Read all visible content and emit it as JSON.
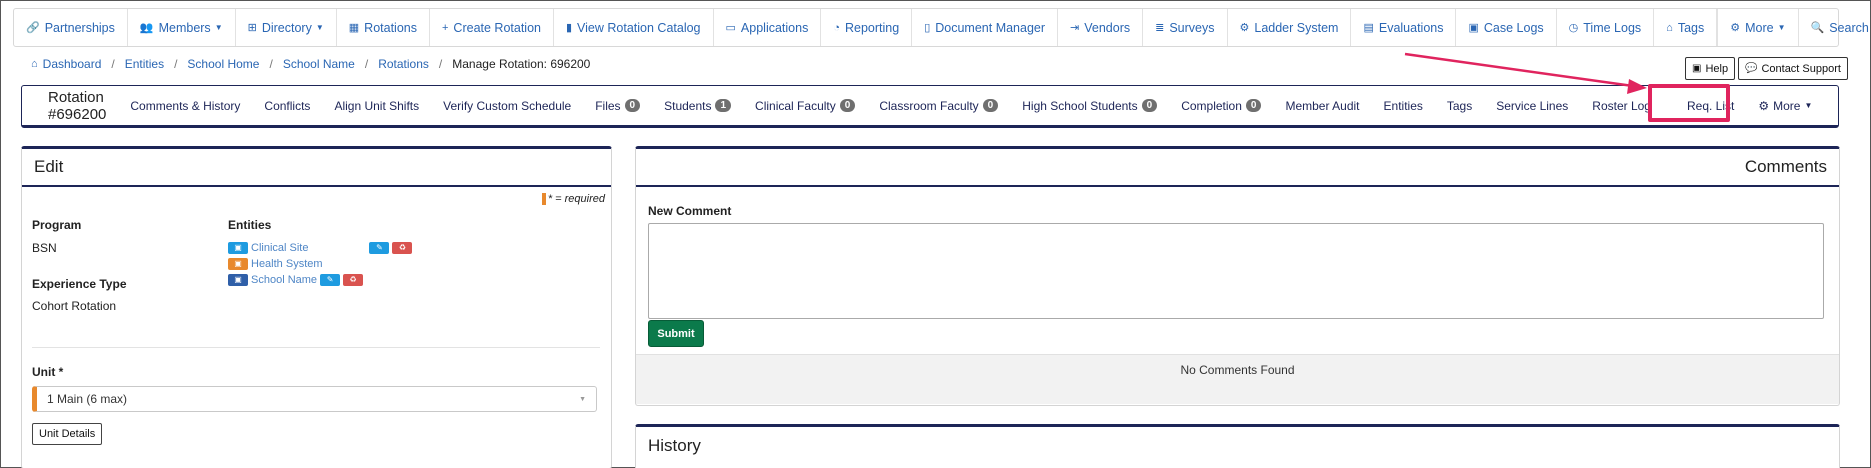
{
  "topnav": {
    "items": [
      {
        "label": "Partnerships",
        "icon": "link-icon",
        "glyph": "🔗",
        "caret": false
      },
      {
        "label": "Members",
        "icon": "users-icon",
        "glyph": "👥",
        "caret": true
      },
      {
        "label": "Directory",
        "icon": "sitemap-icon",
        "glyph": "⊞",
        "caret": true
      },
      {
        "label": "Rotations",
        "icon": "table-icon",
        "glyph": "▦",
        "caret": false
      },
      {
        "label": "Create Rotation",
        "icon": "plus-icon",
        "glyph": "+",
        "caret": false
      },
      {
        "label": "View Rotation Catalog",
        "icon": "book-icon",
        "glyph": "▮",
        "caret": false
      },
      {
        "label": "Applications",
        "icon": "id-card-icon",
        "glyph": "▭",
        "caret": false
      },
      {
        "label": "Reporting",
        "icon": "dashboard-icon",
        "glyph": "◔",
        "caret": false
      },
      {
        "label": "Document Manager",
        "icon": "file-icon",
        "glyph": "▯",
        "caret": false
      },
      {
        "label": "Vendors",
        "icon": "sign-in-icon",
        "glyph": "⇥",
        "caret": false
      },
      {
        "label": "Surveys",
        "icon": "list-icon",
        "glyph": "≣",
        "caret": false
      },
      {
        "label": "Ladder System",
        "icon": "ladder-icon",
        "glyph": "⚙",
        "caret": false
      },
      {
        "label": "Evaluations",
        "icon": "clipboard-icon",
        "glyph": "▤",
        "caret": false
      },
      {
        "label": "Case Logs",
        "icon": "briefcase-icon",
        "glyph": "▣",
        "caret": false
      },
      {
        "label": "Time Logs",
        "icon": "clock-icon",
        "glyph": "◷",
        "caret": false
      },
      {
        "label": "Tags",
        "icon": "tags-icon",
        "glyph": "⌂",
        "caret": false
      }
    ],
    "more_label": "More",
    "search_label": "Search"
  },
  "breadcrumb": {
    "items": [
      "Dashboard",
      "Entities",
      "School Home",
      "School Name",
      "Rotations"
    ],
    "current": "Manage Rotation: 696200"
  },
  "help": {
    "help_label": "Help",
    "contact_label": "Contact Support"
  },
  "rotation_nav": {
    "title": "Rotation #696200",
    "items": [
      {
        "label": "Comments & History",
        "badge": null
      },
      {
        "label": "Conflicts",
        "badge": null
      },
      {
        "label": "Align Unit Shifts",
        "badge": null
      },
      {
        "label": "Verify Custom Schedule",
        "badge": null
      },
      {
        "label": "Files",
        "badge": "0"
      },
      {
        "label": "Students",
        "badge": "1"
      },
      {
        "label": "Clinical Faculty",
        "badge": "0"
      },
      {
        "label": "Classroom Faculty",
        "badge": "0"
      },
      {
        "label": "High School Students",
        "badge": "0"
      },
      {
        "label": "Completion",
        "badge": "0"
      },
      {
        "label": "Member Audit",
        "badge": null
      },
      {
        "label": "Entities",
        "badge": null
      },
      {
        "label": "Tags",
        "badge": null
      },
      {
        "label": "Service Lines",
        "badge": null
      },
      {
        "label": "Roster Log",
        "badge": null
      },
      {
        "label": "Req. List",
        "badge": null
      }
    ],
    "more_label": "More"
  },
  "edit_panel": {
    "title": "Edit",
    "required_note": "* = required",
    "program_label": "Program",
    "program_value": "BSN",
    "experience_label": "Experience Type",
    "experience_value": "Cohort Rotation",
    "entities_label": "Entities",
    "entities": [
      {
        "name": "Clinical Site",
        "color": "#1e9be0"
      },
      {
        "name": "Health System",
        "color": "#e8892d"
      },
      {
        "name": "School Name",
        "color": "#2f5fa8"
      }
    ],
    "unit_label": "Unit *",
    "unit_value": "1 Main (6 max)",
    "unit_details_label": "Unit Details"
  },
  "comments_panel": {
    "title": "Comments",
    "new_comment_label": "New Comment",
    "submit_label": "Submit",
    "empty_text": "No Comments Found"
  },
  "history_panel": {
    "title": "History"
  },
  "colors": {
    "navy": "#1d2557",
    "link": "#2a66b3",
    "highlight": "#e0245e",
    "submit": "#0b7a4b",
    "required": "#e8892d"
  }
}
